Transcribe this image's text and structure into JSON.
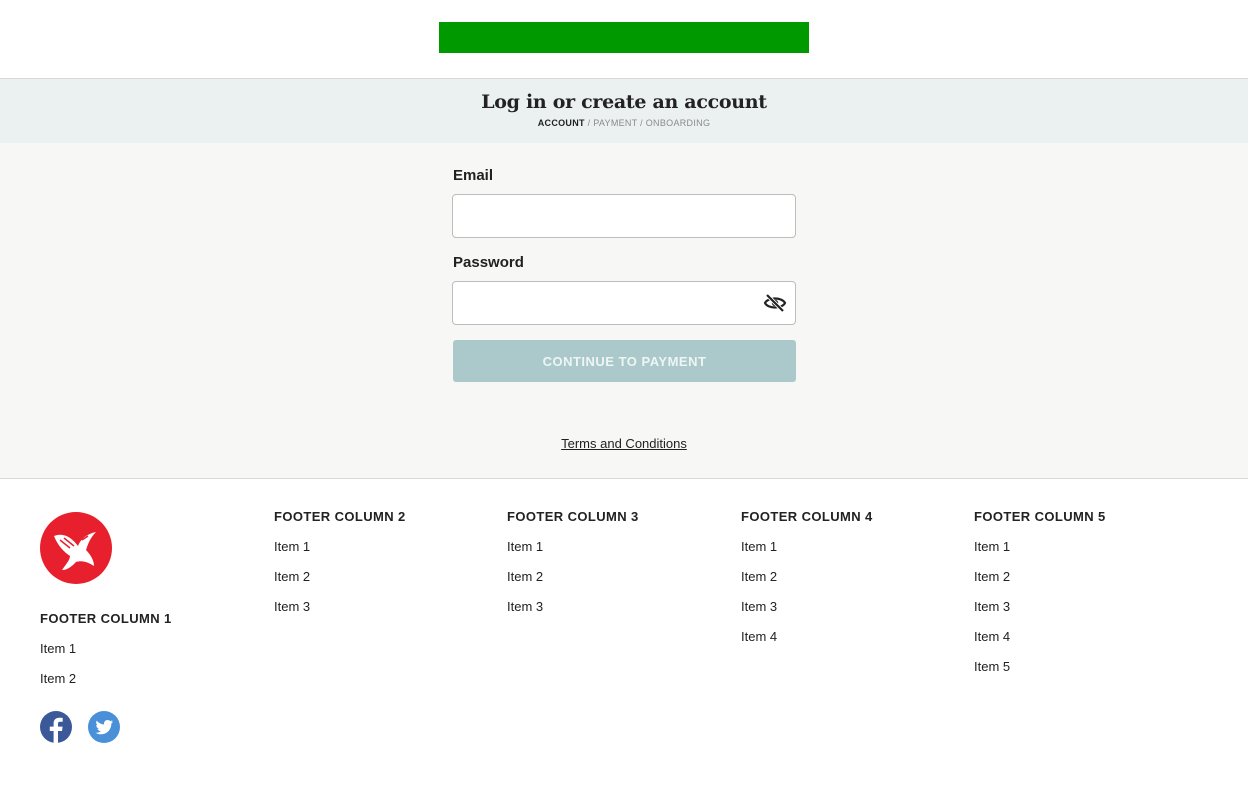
{
  "header": {
    "brand_color": "#009900"
  },
  "titlebar": {
    "background": "#ebf1f1",
    "title": "Log in or create an account",
    "breadcrumb": {
      "active": "ACCOUNT",
      "rest": " / PAYMENT / ONBOARDING"
    }
  },
  "form": {
    "email_label": "Email",
    "email_value": "",
    "password_label": "Password",
    "password_value": "",
    "password_toggle_icon": "eye-off-icon",
    "submit_label": "CONTINUE TO PAYMENT",
    "submit_color": "#abc9cb"
  },
  "terms_link": "Terms and Conditions",
  "footer": {
    "logo_color": "#e8202e",
    "columns": [
      {
        "heading": "FOOTER COLUMN 1",
        "items": [
          "Item 1",
          "Item 2"
        ]
      },
      {
        "heading": "FOOTER COLUMN 2",
        "items": [
          "Item 1",
          "Item 2",
          "Item 3"
        ]
      },
      {
        "heading": "FOOTER COLUMN 3",
        "items": [
          "Item 1",
          "Item 2",
          "Item 3"
        ]
      },
      {
        "heading": "FOOTER COLUMN 4",
        "items": [
          "Item 1",
          "Item 2",
          "Item 3",
          "Item 4"
        ]
      },
      {
        "heading": "FOOTER COLUMN 5",
        "items": [
          "Item 1",
          "Item 2",
          "Item 3",
          "Item 4",
          "Item 5"
        ]
      }
    ],
    "social": [
      {
        "icon": "facebook-icon",
        "color": "#3b5998"
      },
      {
        "icon": "twitter-icon",
        "color": "#4a90d9"
      }
    ]
  }
}
